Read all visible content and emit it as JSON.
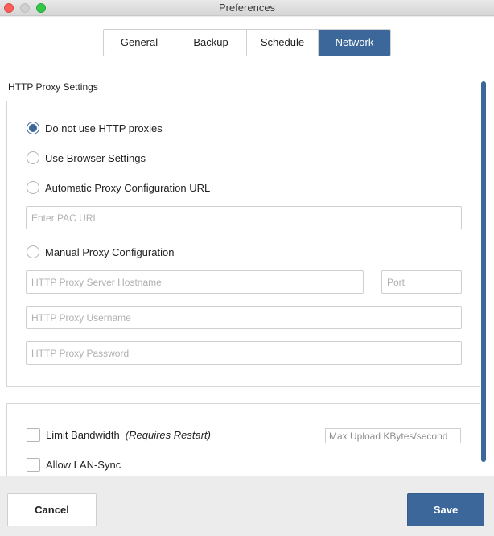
{
  "window": {
    "title": "Preferences"
  },
  "tabs": [
    {
      "label": "General",
      "active": false
    },
    {
      "label": "Backup",
      "active": false
    },
    {
      "label": "Schedule",
      "active": false
    },
    {
      "label": "Network",
      "active": true
    }
  ],
  "proxy": {
    "section_title": "HTTP Proxy Settings",
    "options": [
      {
        "label": "Do not use HTTP proxies",
        "selected": true
      },
      {
        "label": "Use Browser Settings",
        "selected": false
      },
      {
        "label": "Automatic Proxy Configuration URL",
        "selected": false
      },
      {
        "label": "Manual Proxy Configuration",
        "selected": false
      }
    ],
    "pac_url": {
      "value": "",
      "placeholder": "Enter PAC URL"
    },
    "hostname": {
      "value": "",
      "placeholder": "HTTP Proxy Server Hostname"
    },
    "port": {
      "value": "",
      "placeholder": "Port"
    },
    "username": {
      "value": "",
      "placeholder": "HTTP Proxy Username"
    },
    "password": {
      "value": "",
      "placeholder": "HTTP Proxy Password"
    }
  },
  "bandwidth": {
    "limit_label": "Limit Bandwidth",
    "limit_note": "(Requires Restart)",
    "limit_checked": false,
    "max_upload": {
      "value": "",
      "placeholder": "Max Upload KBytes/second"
    },
    "lan_sync_label": "Allow LAN-Sync",
    "lan_sync_checked": false
  },
  "footer": {
    "cancel_label": "Cancel",
    "save_label": "Save"
  },
  "colors": {
    "accent": "#3c679a",
    "background": "#ececec"
  }
}
